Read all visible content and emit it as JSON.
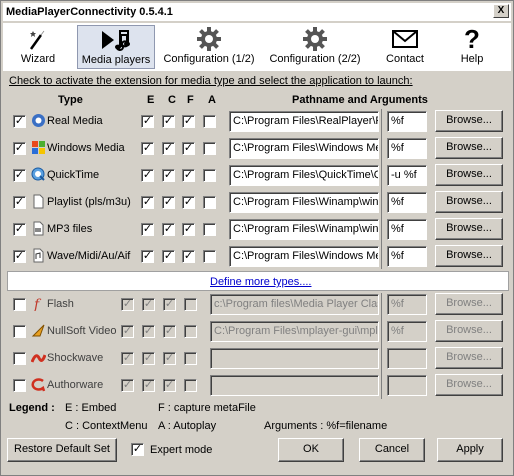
{
  "window": {
    "title": "MediaPlayerConnectivity 0.5.4.1",
    "close_label": "X"
  },
  "toolbar": {
    "wizard": "Wizard",
    "media_players": "Media players",
    "config1": "Configuration (1/2)",
    "config2": "Configuration (2/2)",
    "contact": "Contact",
    "help": "Help"
  },
  "instruction": "Check to activate the extension for media type and select the application to launch:",
  "headers": {
    "type": "Type",
    "e": "E",
    "c": "C",
    "f": "F",
    "a": "A",
    "path": "Pathname and Arguments"
  },
  "rows_active": [
    {
      "label": "Real Media",
      "icon": "realplayer-icon",
      "path": "C:\\Program Files\\RealPlayer\\R",
      "args": "%f",
      "browse": "Browse..."
    },
    {
      "label": "Windows Media",
      "icon": "windows-media-icon",
      "path": "C:\\Program Files\\Windows Me",
      "args": "%f",
      "browse": "Browse..."
    },
    {
      "label": "QuickTime",
      "icon": "quicktime-icon",
      "path": "C:\\Program Files\\QuickTime\\Q",
      "args": "-u %f",
      "browse": "Browse..."
    },
    {
      "label": "Playlist (pls/m3u)",
      "icon": "playlist-file-icon",
      "path": "C:\\Program Files\\Winamp\\win",
      "args": "%f",
      "browse": "Browse..."
    },
    {
      "label": "MP3 files",
      "icon": "mp3-file-icon",
      "path": "C:\\Program Files\\Winamp\\win",
      "args": "%f",
      "browse": "Browse..."
    },
    {
      "label": "Wave/Midi/Au/Aif",
      "icon": "audio-file-icon",
      "path": "C:\\Program Files\\Windows Me",
      "args": "%f",
      "browse": "Browse..."
    }
  ],
  "define_more": "Define more types....",
  "rows_inactive": [
    {
      "label": "Flash",
      "icon": "flash-icon",
      "path": "c:\\Program files\\Media Player Clas",
      "args": "%f",
      "browse": "Browse..."
    },
    {
      "label": "NullSoft Video",
      "icon": "nullsoft-video-icon",
      "path": "C:\\Program Files\\mplayer-gui\\mpl",
      "args": "%f",
      "browse": "Browse..."
    },
    {
      "label": "Shockwave",
      "icon": "shockwave-icon",
      "path": "",
      "args": "",
      "browse": "Browse..."
    },
    {
      "label": "Authorware",
      "icon": "authorware-icon",
      "path": "",
      "args": "",
      "browse": "Browse..."
    }
  ],
  "legend": {
    "title": "Legend :",
    "embed": "E : Embed",
    "capture": "F : capture metaFile",
    "context": "C : ContextMenu",
    "autoplay": "A : Autoplay",
    "arguments": "Arguments : %f=filename"
  },
  "footer": {
    "restore": "Restore Default Set",
    "expert": "Expert mode",
    "expert_checked": true,
    "ok": "OK",
    "cancel": "Cancel",
    "apply": "Apply"
  }
}
